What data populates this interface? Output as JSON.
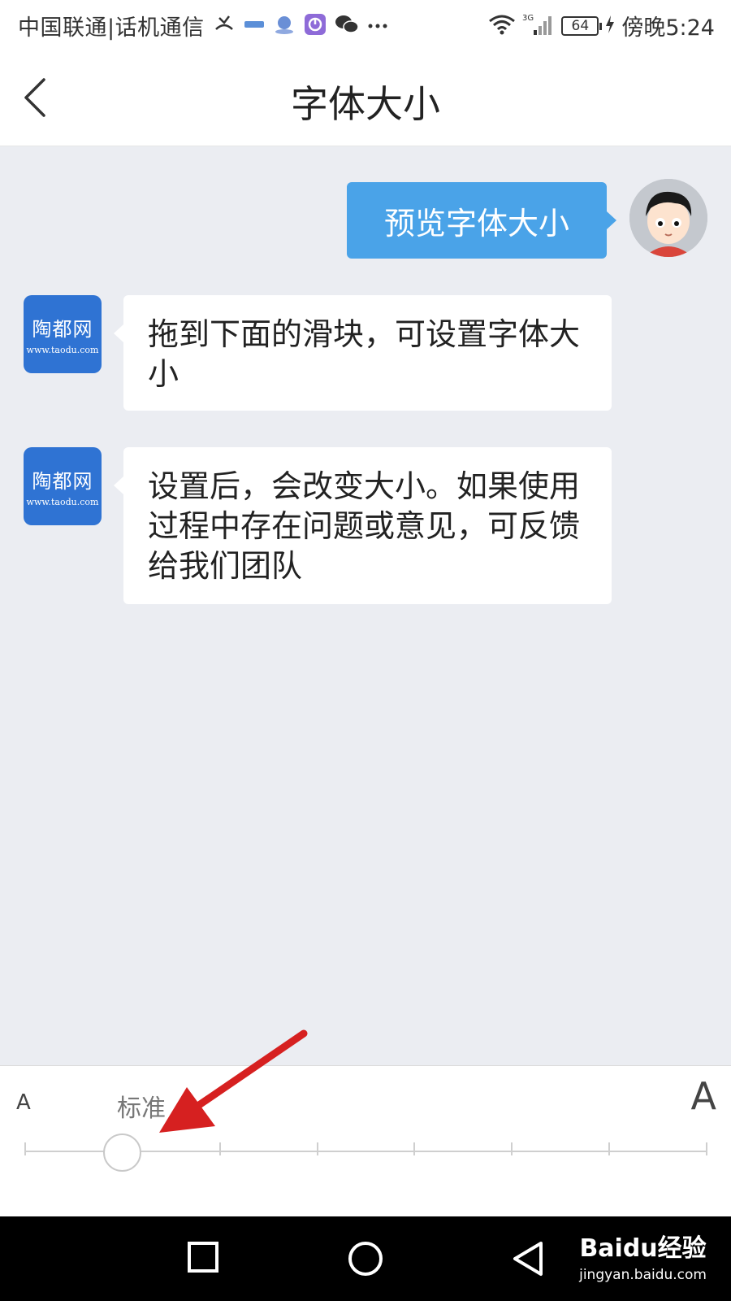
{
  "status_bar": {
    "carrier": "中国联通|话机通信",
    "battery": "64",
    "time": "傍晚5:24",
    "network": "3G"
  },
  "header": {
    "title": "字体大小"
  },
  "chat": {
    "user_message": "预览字体大小",
    "bot_name": "陶都网",
    "bot_domain": "www.taodu.com",
    "bot_messages": [
      "拖到下面的滑块，可设置字体大小",
      "设置后，会改变大小。如果使用过程中存在问题或意见，可反馈给我们团队"
    ]
  },
  "font_size_slider": {
    "small_label": "A",
    "large_label": "A",
    "current_label": "标准",
    "steps": 8,
    "selected_index": 1
  },
  "nav_bar": {
    "watermark_brand": "Baidu经验",
    "watermark_url": "jingyan.baidu.com"
  },
  "colors": {
    "accent_blue": "#4aa3e8",
    "bot_avatar_blue": "#2f73d3",
    "chat_background": "#ebedf2",
    "annotation_red": "#d62020"
  }
}
